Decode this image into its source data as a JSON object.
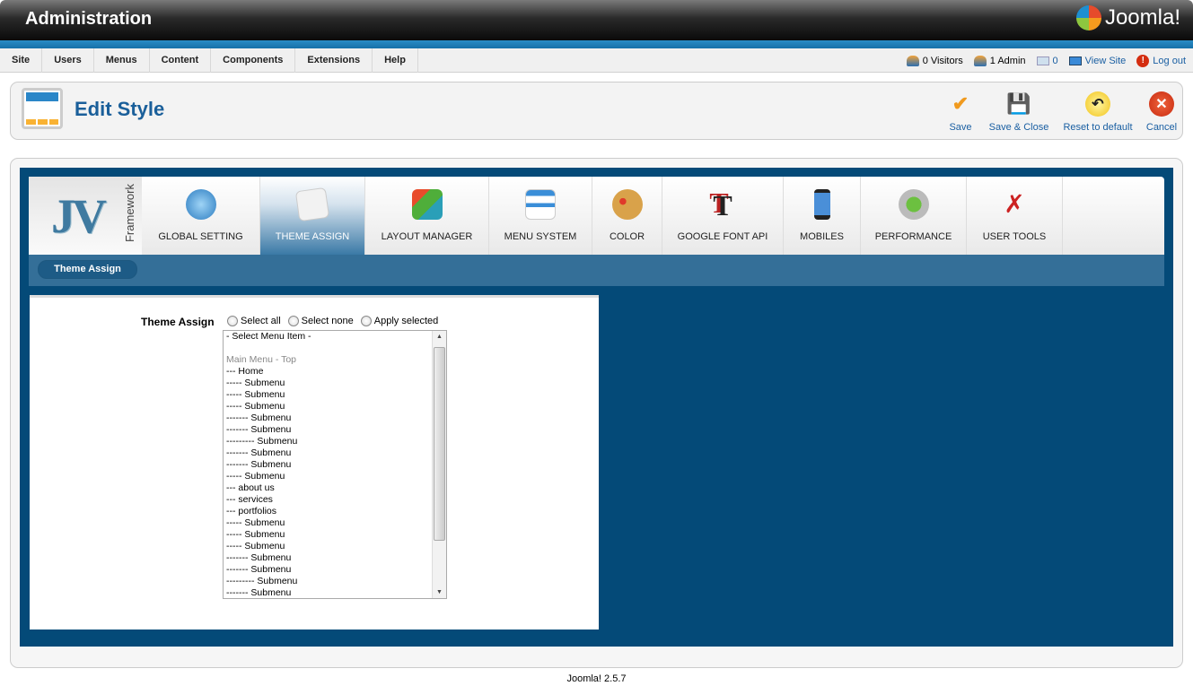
{
  "header": {
    "title": "Administration",
    "logo": "Joomla!"
  },
  "menu": [
    "Site",
    "Users",
    "Menus",
    "Content",
    "Components",
    "Extensions",
    "Help"
  ],
  "status": {
    "visitors": "0 Visitors",
    "admin": "1 Admin",
    "messages": "0",
    "view_site": "View Site",
    "logout": "Log out"
  },
  "toolbar": {
    "title": "Edit Style",
    "save": "Save",
    "save_close": "Save & Close",
    "reset": "Reset to default",
    "cancel": "Cancel"
  },
  "jv": {
    "logo": "JV",
    "sub": "Framework"
  },
  "tabs": [
    "GLOBAL SETTING",
    "THEME ASSIGN",
    "LAYOUT MANAGER",
    "MENU SYSTEM",
    "COLOR",
    "GOOGLE FONT API",
    "MOBILES",
    "PERFORMANCE",
    "USER TOOLS"
  ],
  "active_tab": "THEME ASSIGN",
  "subtab": "Theme Assign",
  "form": {
    "label": "Theme Assign",
    "radios": [
      "Select all",
      "Select none",
      "Apply selected"
    ],
    "options": [
      "- Select Menu Item -",
      "",
      "Main Menu - Top",
      "--- Home",
      "----- Submenu",
      "----- Submenu",
      "----- Submenu",
      "------- Submenu",
      "------- Submenu",
      "--------- Submenu",
      "------- Submenu",
      "------- Submenu",
      "----- Submenu",
      "--- about us",
      "--- services",
      "--- portfolios",
      "----- Submenu",
      "----- Submenu",
      "----- Submenu",
      "------- Submenu",
      "------- Submenu",
      "--------- Submenu",
      "------- Submenu"
    ]
  },
  "footer": "Joomla! 2.5.7"
}
